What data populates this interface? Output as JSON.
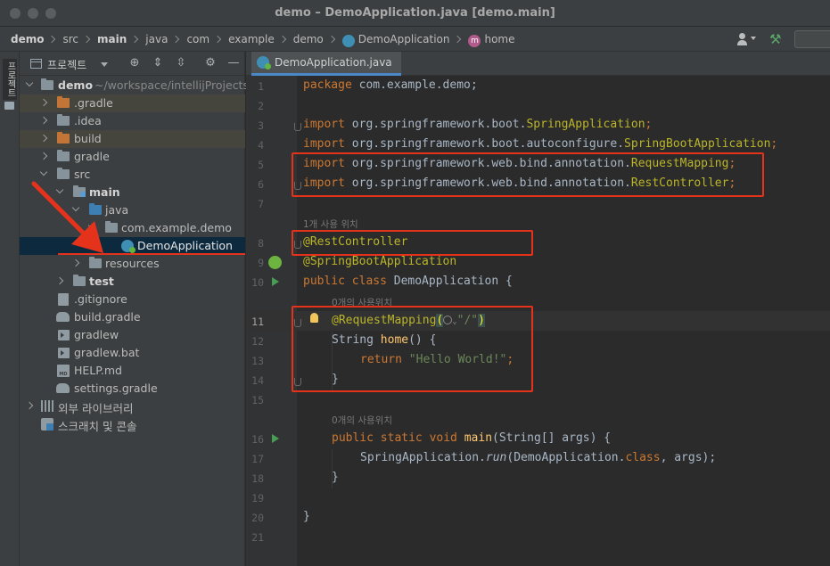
{
  "window": {
    "title": "demo – DemoApplication.java [demo.main]"
  },
  "breadcrumbs": [
    "demo",
    "src",
    "main",
    "java",
    "com",
    "example",
    "demo",
    "DemoApplication",
    "home"
  ],
  "method_icon_letter": "m",
  "project_panel": {
    "strip_label": "프로젝트",
    "title": "프로젝트",
    "toolbar_icons": [
      "crosshair-icon",
      "expand-all-icon",
      "collapse-all-icon",
      "gear-icon",
      "minimize-icon"
    ],
    "toolbar_glyphs": {
      "locate": "⊕",
      "expand": "⇕",
      "collapse": "⇳",
      "gear": "⚙",
      "minimize": "—"
    }
  },
  "tree": [
    {
      "label": "demo",
      "path": "~/workspace/intellijProjects/"
    },
    {
      "label": ".gradle"
    },
    {
      "label": ".idea"
    },
    {
      "label": "build"
    },
    {
      "label": "gradle"
    },
    {
      "label": "src"
    },
    {
      "label": "main"
    },
    {
      "label": "java"
    },
    {
      "label": "com.example.demo"
    },
    {
      "label": "DemoApplication"
    },
    {
      "label": "resources"
    },
    {
      "label": "test"
    },
    {
      "label": ".gitignore"
    },
    {
      "label": "build.gradle"
    },
    {
      "label": "gradlew"
    },
    {
      "label": "gradlew.bat"
    },
    {
      "label": "HELP.md"
    },
    {
      "label": "settings.gradle"
    },
    {
      "label": "외부 라이브러리"
    },
    {
      "label": "스크래치 및 콘솔"
    }
  ],
  "md_icon_text": "MD",
  "editor": {
    "tab_label": "DemoApplication.java",
    "line_numbers": [
      "1",
      "2",
      "3",
      "4",
      "5",
      "6",
      "7",
      "8",
      "9",
      "10",
      "11",
      "12",
      "13",
      "14",
      "15",
      "16",
      "17",
      "18",
      "19",
      "20",
      "21"
    ],
    "usage_hints": [
      "1개 사용 위치",
      "0개의 사용위치",
      "0개의 사용위치"
    ],
    "code": {
      "l1_kw": "package",
      "l1_rest": " com.example.demo;",
      "import_kw": "import",
      "l3_pkg": " org.springframework.boot.",
      "l3_cls": "SpringApplication",
      "l4_pkg": " org.springframework.boot.autoconfigure.",
      "l4_cls": "SpringBootApplication",
      "l5_pkg": " org.springframework.web.bind.annotation.",
      "l5_cls": "RequestMapping",
      "l6_pkg": " org.springframework.web.bind.annotation.",
      "l6_cls": "RestController",
      "semi": ";",
      "l8": "@RestController",
      "l9": "@SpringBootApplication",
      "l10_kw": "public class",
      "l10_rest": " DemoApplication {",
      "l11_ann": "@RequestMapping",
      "l11_open": "(",
      "l11_str": "\"/\"",
      "l11_close": ")",
      "l12_type": "String ",
      "l12_fn": "home",
      "l12_rest": "() {",
      "l13_kw": "return",
      "l13_str": " \"Hello World!\"",
      "l14": "}",
      "l16_kw": "public static void",
      "l16_fn": " main",
      "l16_rest": "(String[] args) {",
      "l17_a": "SpringApplication.",
      "l17_run": "run",
      "l17_b": "(DemoApplication.",
      "l17_kw": "class",
      "l17_c": ", args);",
      "l18": "}",
      "l20": "}"
    }
  },
  "colors": {
    "annotation_red": "#e5321b",
    "selection": "#0d293e",
    "accent_blue": "#4a88c7"
  }
}
